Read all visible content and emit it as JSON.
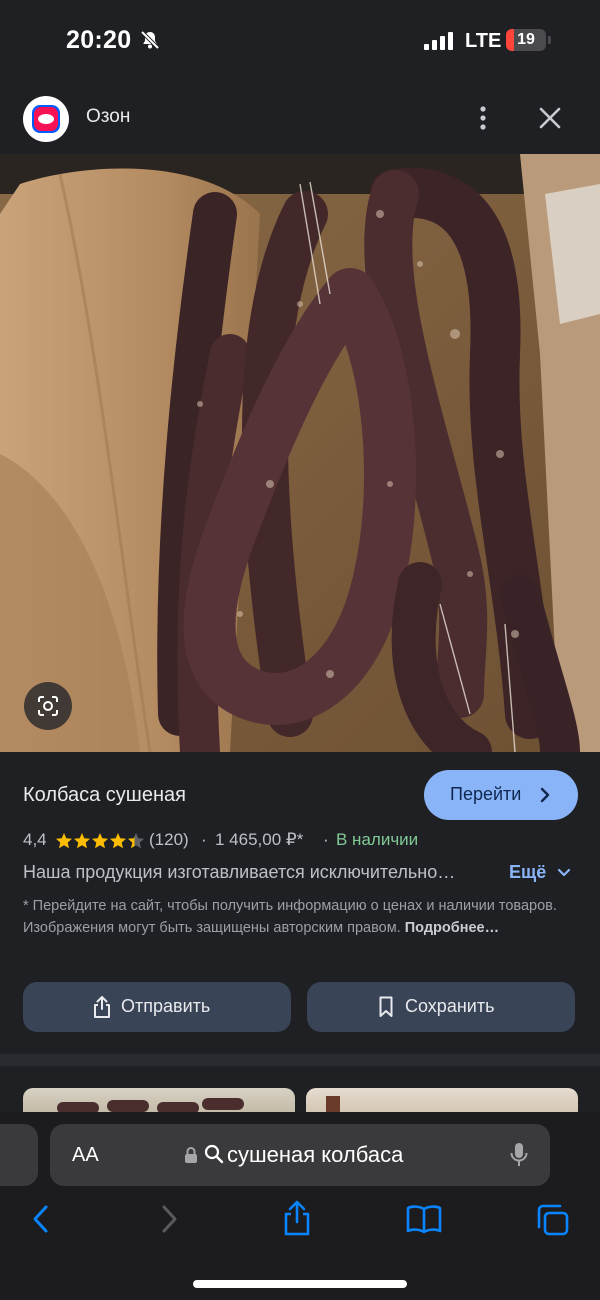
{
  "status_bar": {
    "time": "20:20",
    "network": "LTE",
    "battery_level": "19",
    "battery_color": "#ff453a",
    "icons": [
      "bell-slash-icon",
      "signal-icon",
      "battery-icon"
    ]
  },
  "header": {
    "site_name": "Озон",
    "logo_icon": "ozon-logo-icon",
    "more_icon": "more-vertical-icon",
    "close_icon": "close-icon"
  },
  "image": {
    "lens_icon": "lens-icon"
  },
  "product": {
    "title": "Колбаса сушеная",
    "go_button": "Перейти",
    "rating": "4,4",
    "stars": 4.4,
    "reviews": "(120)",
    "separator": "·",
    "price": "1 465,00 ₽*",
    "availability": "В наличии",
    "description": "Наша продукция изготавливается исключительно…",
    "more_label": "Ещё",
    "disclaimer": "* Перейдите на сайт, чтобы получить информацию о ценах и наличии товаров. Изображения могут быть защищены авторским правом.",
    "disclaimer_link": "Подробнее…",
    "share_button": "Отправить",
    "save_button": "Сохранить"
  },
  "browser": {
    "aa_label": "AA",
    "url_text": "сушеная колбаса",
    "toolbar_icons": [
      "back-icon",
      "forward-icon",
      "share-icon",
      "bookmarks-icon",
      "tabs-icon"
    ],
    "accent": "#0a84ff"
  }
}
